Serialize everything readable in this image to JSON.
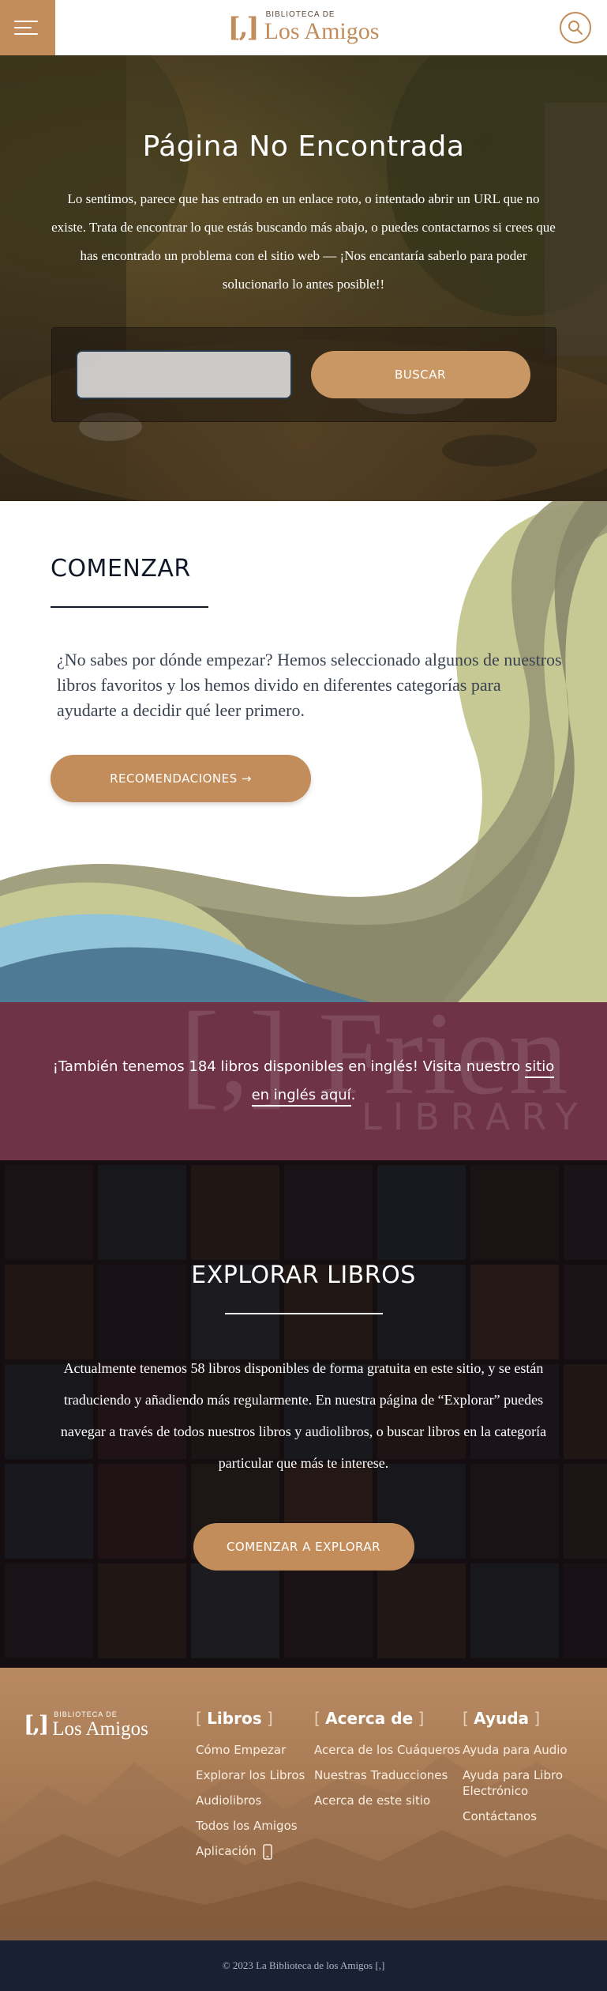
{
  "header": {
    "logo_small": "BIBLIOTECA DE",
    "logo_big": "Los Amigos",
    "logo_bracket": "[,]",
    "menu_icon": "hamburger-icon",
    "search_icon": "search-icon"
  },
  "hero": {
    "title": "Página No Encontrada",
    "text": "Lo sentimos, parece que has entrado en un enlace roto, o intentado abrir un URL que no existe. Trata de encontrar lo que estás buscando más abajo, o puedes contactarnos si crees que has encontrado un problema con el sitio web — ¡Nos encantaría saberlo para poder solucionarlo lo antes posible!!",
    "search_value": "",
    "search_button": "BUSCAR"
  },
  "start": {
    "title": "COMENZAR",
    "text": "¿No sabes por dónde empezar? Hemos seleccionado algunos de nuestros libros favoritos y los hemos divido en diferentes categorías para ayudarte a decidir qué leer primero.",
    "button": "RECOMENDACIONES →"
  },
  "english_banner": {
    "text_before": "¡También tenemos 184 libros disponibles en inglés! Visita nuestro ",
    "link": "sitio en inglés aquí",
    "text_after": ".",
    "bg_mark": "[,] Frien",
    "bg_sub": "LIBRARY"
  },
  "explore": {
    "title": "EXPLORAR LIBROS",
    "text": "Actualmente tenemos 58 libros disponibles de forma gratuita en este sitio, y se están traduciendo y añadiendo más regularmente. En nuestra página de “Explorar” puedes navegar a través de todos nuestros libros y audiolibros, o buscar libros en la categoría particular que más te interese.",
    "button": "COMENZAR A EXPLORAR"
  },
  "footer": {
    "logo_small": "BIBLIOTECA DE",
    "logo_big": "Los Amigos",
    "logo_bracket": "[,]",
    "columns": [
      {
        "title": "Libros",
        "links": [
          "Cómo Empezar",
          "Explorar los Libros",
          "Audiolibros",
          "Todos los Amigos",
          "Aplicación"
        ]
      },
      {
        "title": "Acerca de",
        "links": [
          "Acerca de los Cuáqueros",
          "Nuestras Traducciones",
          "Acerca de este sitio"
        ]
      },
      {
        "title": "Ayuda",
        "links": [
          "Ayuda para Audio",
          "Ayuda para Libro Electrónico",
          "Contáctanos"
        ]
      }
    ],
    "copyright": "© 2023 La Biblioteca de los Amigos [,]"
  },
  "colors": {
    "accent": "#c28d5a",
    "banner": "#6e3346",
    "dark": "#1a2033"
  }
}
